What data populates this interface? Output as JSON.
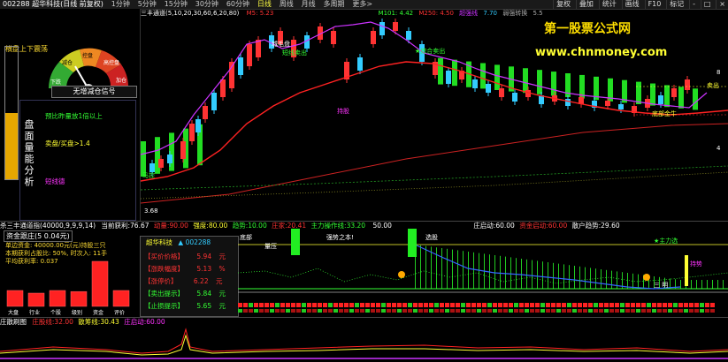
{
  "top_bar": {
    "code": "002288 超华科技(日线 前复权)",
    "periods": [
      "1分钟",
      "5分钟",
      "15分钟",
      "30分钟",
      "60分钟",
      "日线",
      "周线",
      "月线",
      "多周期",
      "更多>"
    ],
    "active_period": "日线",
    "right_buttons": [
      "复权",
      "叠加",
      "统计",
      "画线",
      "F10",
      "标记",
      "-",
      "□",
      "×"
    ]
  },
  "chart_header": {
    "indicator": "三丰通道(5,10,20,30,60,6,20,80)",
    "ma5": "M5: 5.23",
    "m101": "M101: 4.42",
    "m250": "M250: 4.50",
    "extra1": "超强线",
    "extra2": "7.70",
    "extra3": "弱强转换",
    "extra4": "5.5"
  },
  "watermark": {
    "line1": "第一股票公式网",
    "line2": "www.chnmoney.com"
  },
  "left_panel": {
    "gauge_title": "横盘上下震荡",
    "gauge_labels": [
      "下跌",
      "减仓",
      "控盘",
      "高控盘",
      "加仓"
    ],
    "signal_label": "无增减仓信号",
    "vertical_label": "盘面量能分析",
    "bar_fill_fraction": 0.5,
    "lines": [
      {
        "text": "预比昨量放1倍以上",
        "color": "#33ff33"
      },
      {
        "text": "卖盘/买盘>1.4",
        "color": "#ffff33"
      },
      {
        "text": "短线德",
        "color": "#ff33ff"
      }
    ]
  },
  "chart_labels": {
    "l1": "城毛盘",
    "l2": "短线卖出",
    "l3": "★综合卖出",
    "l4": "持股",
    "l5": "底部金牛",
    "l6": "卖出",
    "l7": "马控",
    "l8": "3.68",
    "l9": "8",
    "l10": "4"
  },
  "mid_header": {
    "title": "杀三丰通道指(40000,9,9,9,14)",
    "v1_label": "当前获利:",
    "v1": "76.67",
    "v2_label": "动量:",
    "v2": "90.00",
    "v3_label": "强度:",
    "v3": "80.00",
    "v4_label": "趋势:",
    "v4": "10.00",
    "v5_label": "庄家:",
    "v5": "20.41",
    "v6_label": "主力操作线:",
    "v6": "33.20",
    "v7": "50.00",
    "v8_label": "庄启动:",
    "v8": "60.00",
    "v9_label": "资金启动:",
    "v9": "60.00",
    "v10_label": "散户趋势:",
    "v10": "29.60"
  },
  "bottom_left": {
    "title": "资金跟庄(5 0.04元)",
    "lines": [
      "单边资金: 40000.00元(元)持股三只",
      "本期获利占股比: 50%, 时次入: 11手",
      "平均获利率: 0.037"
    ],
    "bars": [
      {
        "label": "大盘",
        "value": 0.3
      },
      {
        "label": "行业",
        "value": 0.25
      },
      {
        "label": "个股",
        "value": 0.3
      },
      {
        "label": "级别",
        "value": 0.28
      },
      {
        "label": "资金",
        "value": 0.85
      },
      {
        "label": "评价",
        "value": 0.3
      }
    ]
  },
  "stock_box": {
    "name": "超华科技",
    "code": "002288",
    "rows": [
      {
        "label": "【买价价格】",
        "value": "5.94",
        "unit": "元"
      },
      {
        "label": "【涨跌幅度】",
        "value": "5.13",
        "unit": "%"
      },
      {
        "label": "【涨停价】",
        "value": "6.22",
        "unit": "元"
      },
      {
        "label": "【卖出提示】",
        "value": "5.84",
        "unit": "元"
      },
      {
        "label": "【止损提示】",
        "value": "5.65",
        "unit": "元"
      }
    ]
  },
  "ind_labels": {
    "a": "底部",
    "b": "强势之本!",
    "c": "选股",
    "d": "★主力选",
    "e": "量压",
    "f": "三 明",
    "g": "持势"
  },
  "bottom_header": {
    "title": "庄散刷图",
    "v1_label": "庄股线:",
    "v1": "32.00",
    "v2_label": "散筹线:",
    "v2": "30.43",
    "v3_label": "庄启动:",
    "v3": "60.00"
  },
  "colors": {
    "up": "#ff3333",
    "down": "#33ccff",
    "ma_green": "#33ff33",
    "ma_purple": "#cc33ff",
    "ma_red": "#ff2222",
    "accent_yellow": "#ffff33"
  }
}
